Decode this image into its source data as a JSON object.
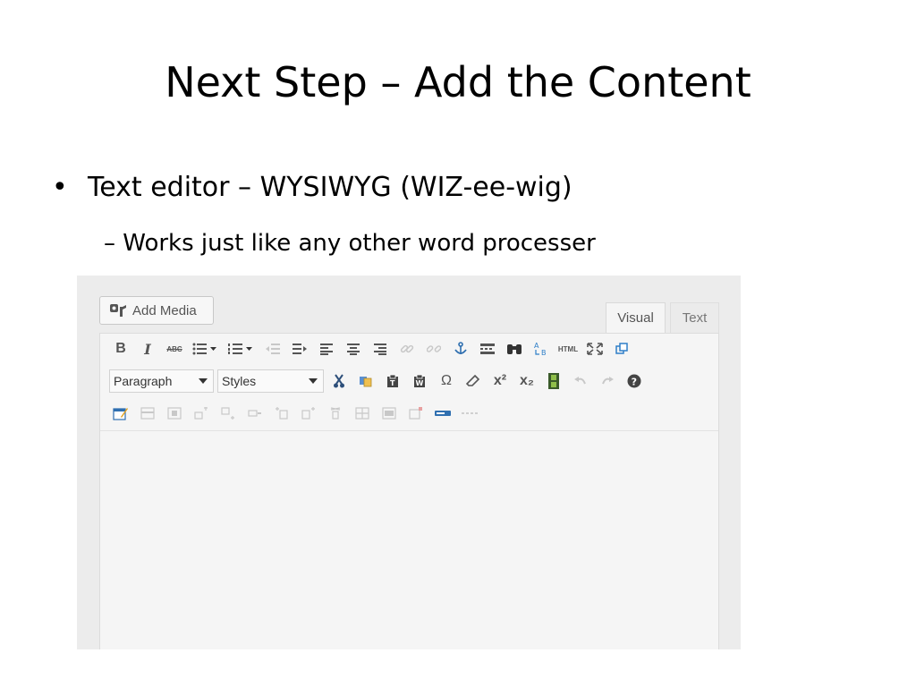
{
  "slide": {
    "title": "Next Step – Add the Content",
    "bullet1": "Text editor – WYSIWYG (WIZ-ee-wig)",
    "bullet1_marker": "•",
    "bullet2": "– Works just like any other word processer"
  },
  "editor": {
    "add_media_label": "Add Media",
    "tabs": {
      "visual": "Visual",
      "text": "Text"
    },
    "toolbar": {
      "bold": "B",
      "italic": "I",
      "strike": "ABC",
      "html": "HTML",
      "omega": "Ω",
      "superscript": "x²",
      "subscript": "x₂",
      "help": "?",
      "paragraph_select": "Paragraph",
      "styles_select": "Styles"
    }
  },
  "colors": {
    "accent_blue": "#2f7fc8",
    "icon_gray": "#555555",
    "disabled_gray": "#c8c8c8"
  }
}
